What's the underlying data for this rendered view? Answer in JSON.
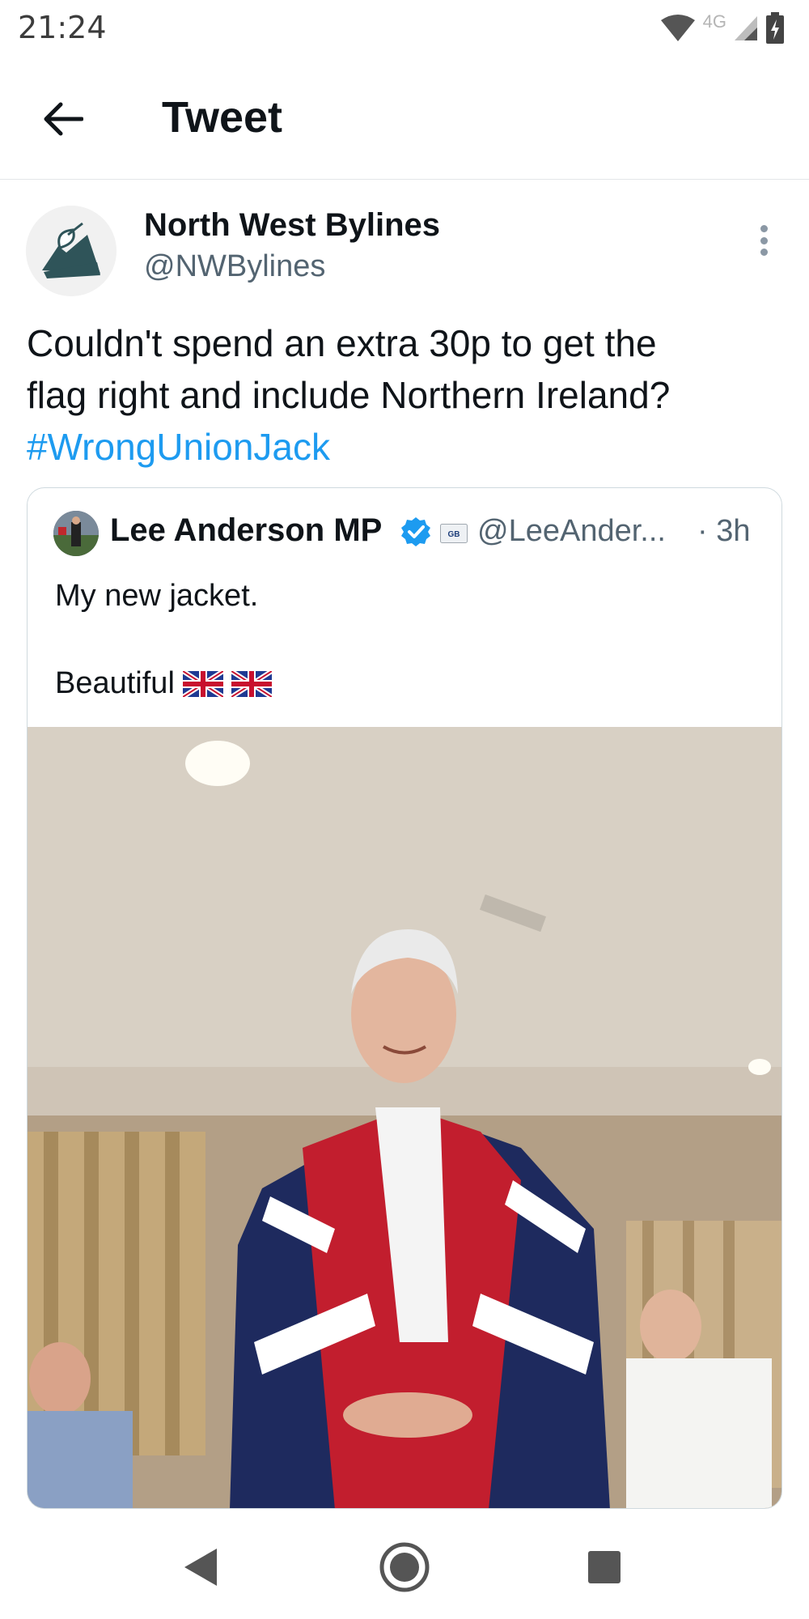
{
  "status_bar": {
    "time": "21:24",
    "network": "4G"
  },
  "top_bar": {
    "title": "Tweet"
  },
  "tweet": {
    "author_name": "North West Bylines",
    "author_handle": "@NWBylines",
    "text_line1": "Couldn't spend an extra 30p to get the",
    "text_line2": "flag right and include Northern Ireland?",
    "hashtag": "#WrongUnionJack"
  },
  "quote": {
    "author_name": "Lee Anderson MP",
    "handle": "@LeeAnder...",
    "time": "· 3h",
    "text_line1": "My new jacket.",
    "text_line2": "Beautiful",
    "badge_text": "GB",
    "image_icon": "photo-of-man-in-union-jack-jacket"
  },
  "colors": {
    "accent": "#1d9bf0",
    "text": "#0f1419",
    "secondary_text": "#536471",
    "border": "#cfd9de"
  },
  "icons": {
    "back": "arrow-left-icon",
    "more": "more-vertical-icon",
    "verified": "verified-badge-icon",
    "nav_back": "triangle-back-icon",
    "nav_home": "circle-home-icon",
    "nav_recents": "square-recents-icon"
  }
}
